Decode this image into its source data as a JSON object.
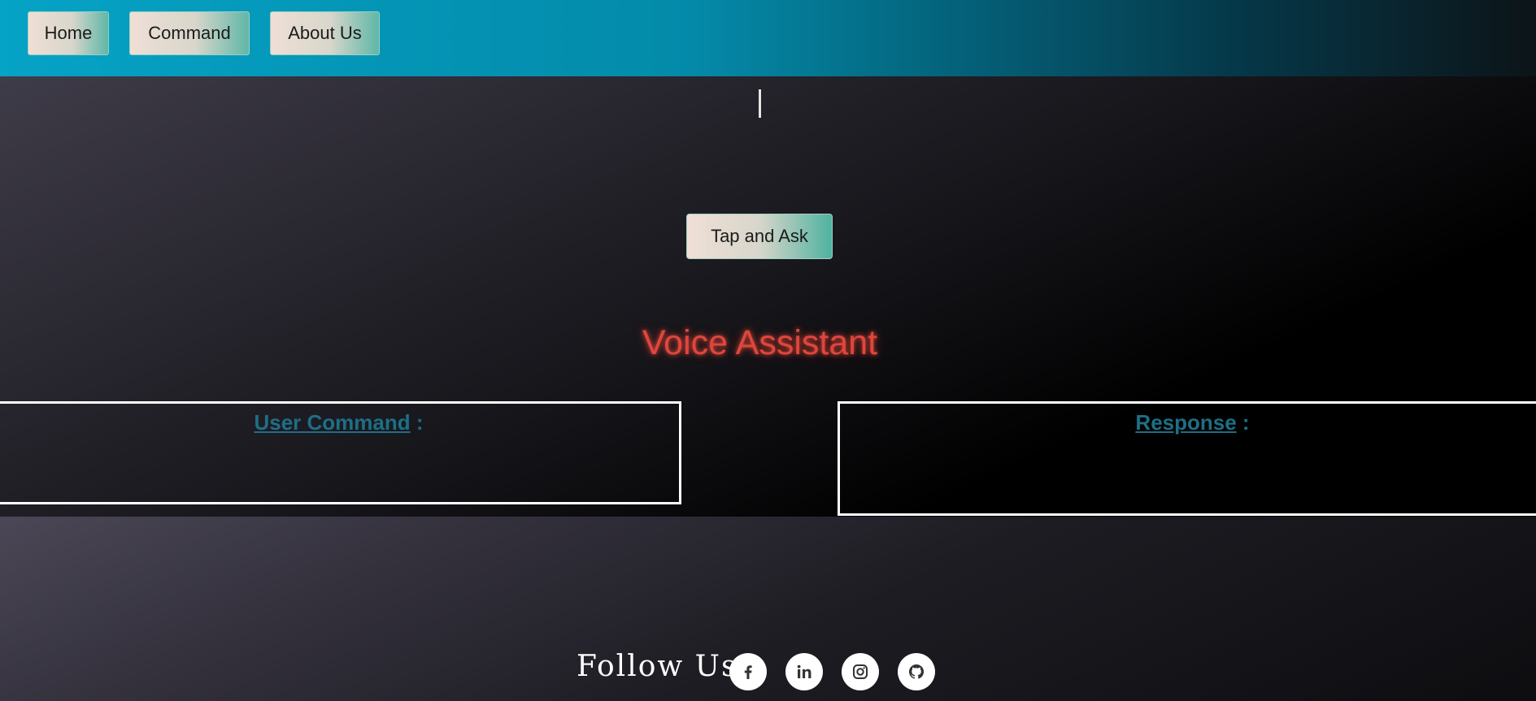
{
  "nav": {
    "items": [
      {
        "label": "Home"
      },
      {
        "label": "Command"
      },
      {
        "label": "About Us"
      }
    ]
  },
  "main": {
    "ask_button": "Tap and Ask",
    "title": "Voice Assistant",
    "user_command": {
      "label": "User Command",
      "suffix": " :",
      "value": ""
    },
    "response": {
      "label": "Response",
      "suffix": " :",
      "value": ""
    }
  },
  "footer": {
    "follow_label": "Follow Us",
    "social": [
      "facebook-icon",
      "linkedin-icon",
      "instagram-icon",
      "github-icon"
    ]
  },
  "colors": {
    "navbar_start": "#05a3c6",
    "title": "#e0463c",
    "panel_heading": "#1d6f86"
  }
}
